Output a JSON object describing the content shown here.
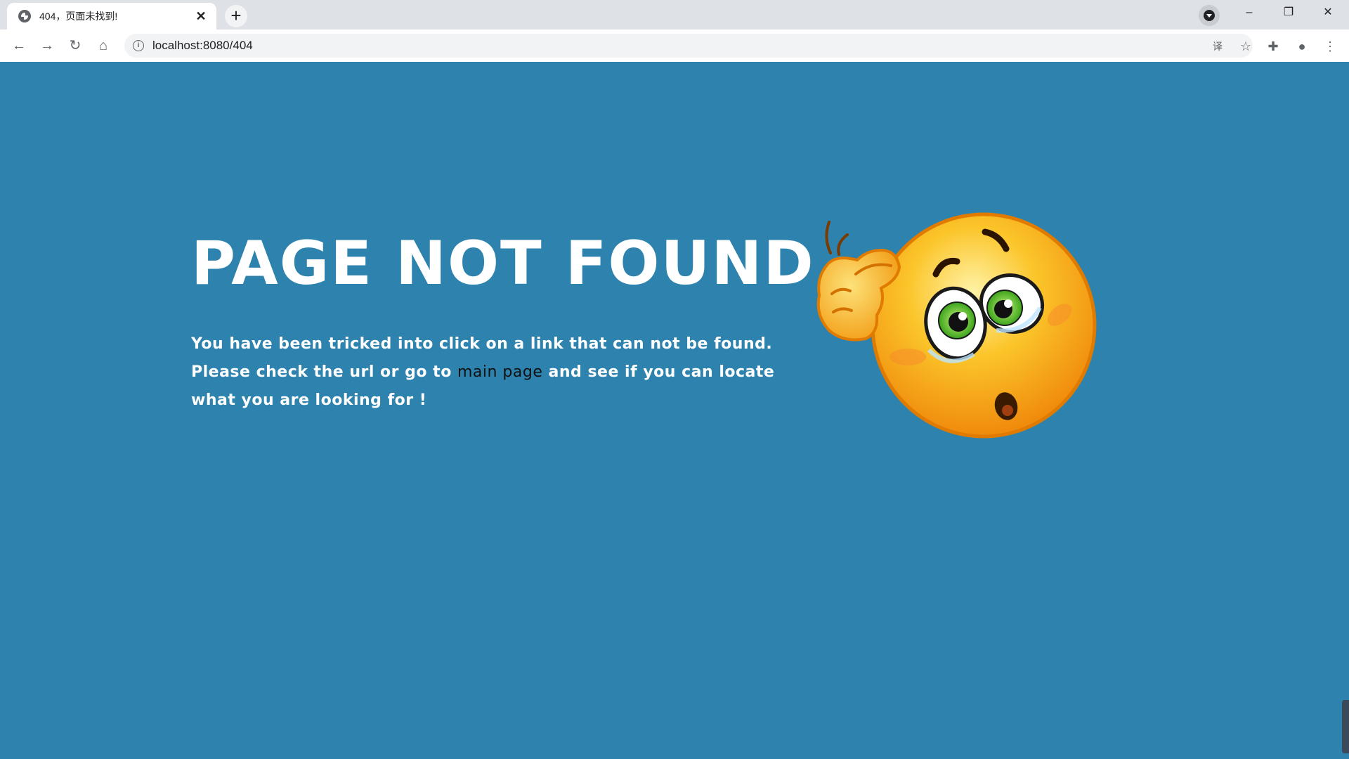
{
  "tab": {
    "title": "404，页面未找到!",
    "close": "✕",
    "new_tab": "+"
  },
  "window_controls": {
    "minimize": "–",
    "restore": "❐",
    "close": "✕"
  },
  "nav": {
    "back": "←",
    "forward": "→",
    "reload": "↻",
    "home": "⌂"
  },
  "omnibox": {
    "info_glyph": "i",
    "url": "localhost:8080/404"
  },
  "toolbar_icons": {
    "translate": "译",
    "bookmark": "☆",
    "extensions": "✚",
    "profile": "●",
    "menu": "⋮"
  },
  "page": {
    "headline": "PAGE NOT FOUND",
    "message_part1": "You have been tricked into click on a link that can not be found. Please check the url or go to ",
    "link_text": "main page",
    "message_part2": " and see if you can locate what you are looking for !"
  },
  "colors": {
    "page_background": "#2d83ae",
    "headline_text": "#ffffff",
    "link_text": "#101010",
    "emoji_face": "#fbb516"
  }
}
